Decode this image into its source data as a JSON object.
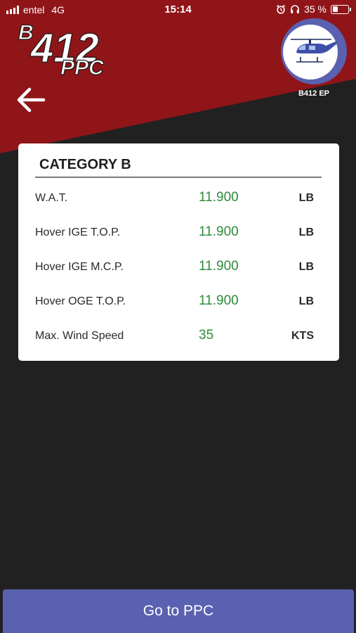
{
  "status_bar": {
    "carrier": "entel",
    "network": "4G",
    "time": "15:14",
    "battery": "35 %",
    "battery_level": 0.35
  },
  "header": {
    "logo_text": "B412 PPC",
    "aircraft_label": "B412 EP"
  },
  "card": {
    "title": "CATEGORY B",
    "rows": [
      {
        "label": "W.A.T.",
        "value": "11.900",
        "unit": "LB"
      },
      {
        "label": "Hover IGE T.O.P.",
        "value": "11.900",
        "unit": "LB"
      },
      {
        "label": "Hover IGE M.C.P.",
        "value": "11.900",
        "unit": "LB"
      },
      {
        "label": "Hover OGE T.O.P.",
        "value": "11.900",
        "unit": "LB"
      },
      {
        "label": "Max. Wind Speed",
        "value": "35",
        "unit": "KTS"
      }
    ]
  },
  "footer": {
    "button_label": "Go to PPC"
  },
  "colors": {
    "header_red": "#8f1519",
    "background": "#212121",
    "value_green": "#2e8b3a",
    "button_blue": "#5a61b0"
  },
  "icons": [
    "signal-icon",
    "alarm-icon",
    "headphones-icon",
    "battery-icon",
    "back-arrow-icon",
    "helicopter-icon"
  ]
}
